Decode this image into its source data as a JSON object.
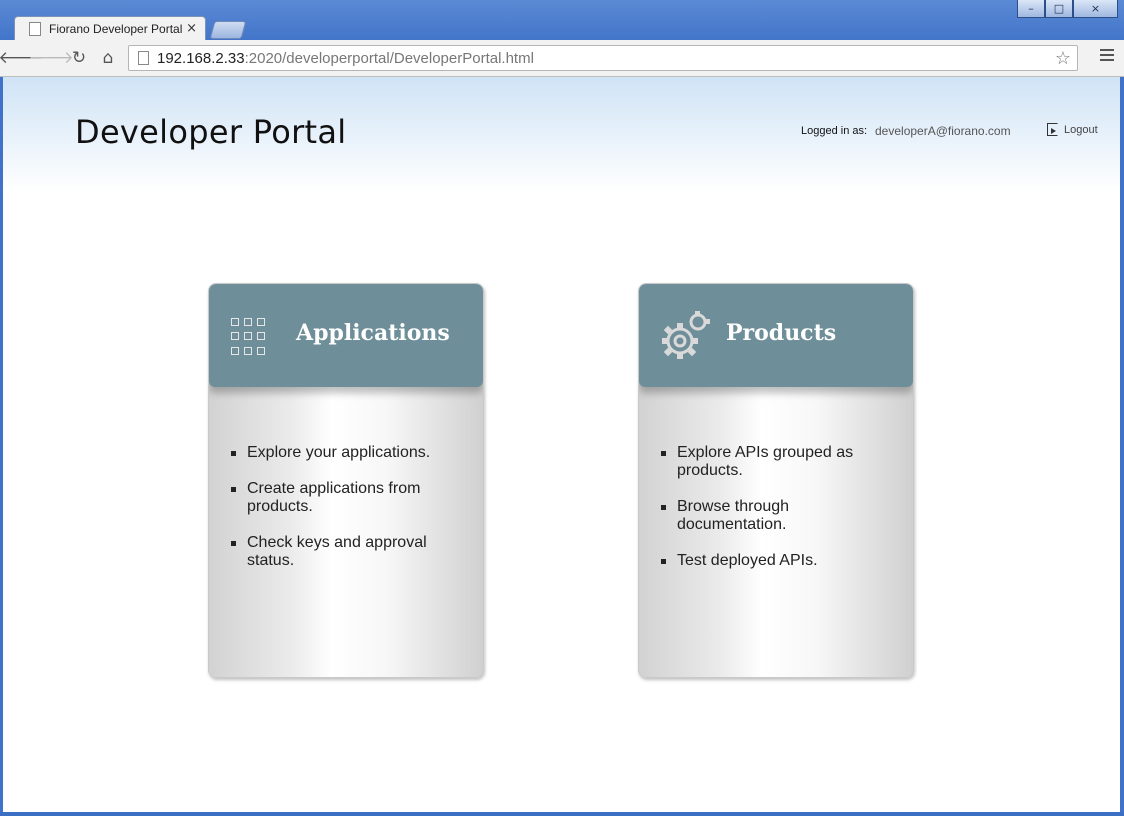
{
  "browser": {
    "tab_title": "Fiorano Developer Portal",
    "tab_close": "×",
    "url_host": "192.168.2.33",
    "url_rest": ":2020/developerportal/DeveloperPortal.html"
  },
  "window_controls": {
    "minimize": "–",
    "maximize": "□",
    "close": "×"
  },
  "header": {
    "title": "Developer Portal",
    "logged_in_label": "Logged in as:",
    "user": "developerA@fiorano.com",
    "logout": "Logout"
  },
  "cards": [
    {
      "title": "Applications",
      "icon": "grid-icon",
      "items": [
        "Explore your applications.",
        "Create applications from products.",
        "Check keys and approval status."
      ]
    },
    {
      "title": "Products",
      "icon": "gear-icon",
      "items": [
        "Explore APIs grouped as products.",
        "Browse through documentation.",
        "Test deployed APIs."
      ]
    }
  ],
  "colors": {
    "card_header": "#6e8f99",
    "chrome_blue": "#3f72c8"
  }
}
